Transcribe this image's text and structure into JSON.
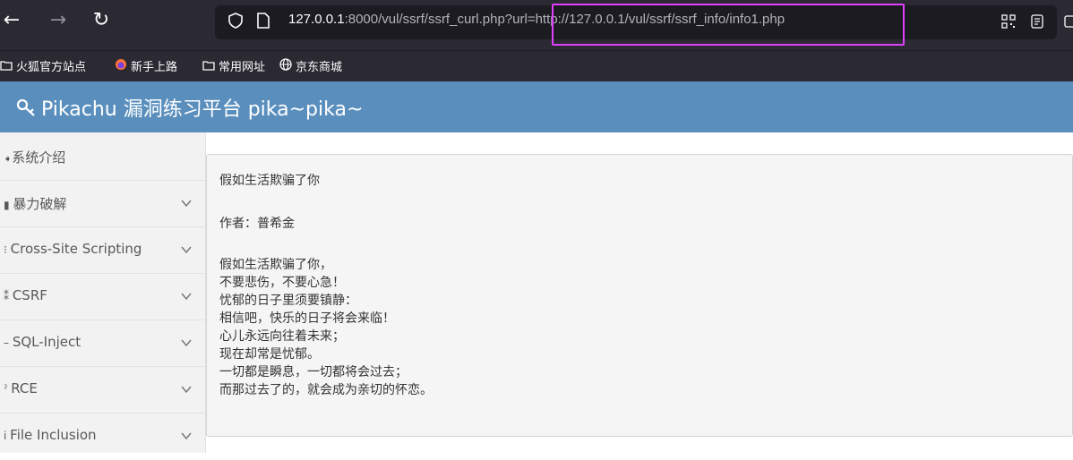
{
  "browser": {
    "url_host": "127.0.0.1",
    "url_rest": ":8000/vul/ssrf/ssrf_curl.php?url=http://127.0.0.1/vul/ssrf/ssrf_info/info1.php",
    "bookmarks": [
      "火狐官方站点",
      "新手上路",
      "常用网址",
      "京东商城"
    ]
  },
  "header": {
    "title": "Pikachu 漏洞练习平台 pika~pika~"
  },
  "sidebar": {
    "items": [
      {
        "label": "系统介绍",
        "icon": "arrow-circle-icon"
      },
      {
        "label": "暴力破解",
        "icon": "lock-icon"
      },
      {
        "label": "Cross-Site Scripting",
        "icon": "list-icon"
      },
      {
        "label": "CSRF",
        "icon": "exchange-icon"
      },
      {
        "label": "SQL-Inject",
        "icon": "minus-icon"
      },
      {
        "label": "RCE",
        "icon": "pin-icon"
      },
      {
        "label": "File Inclusion",
        "icon": "info-icon"
      }
    ]
  },
  "poem": {
    "title": "假如生活欺骗了你",
    "author": "作者：普希金",
    "lines": [
      "假如生活欺骗了你，",
      "不要悲伤，不要心急！",
      "忧郁的日子里须要镇静：",
      "相信吧，快乐的日子将会来临！",
      "心儿永远向往着未来；",
      "现在却常是忧郁。",
      "一切都是瞬息，一切都将会过去；",
      "而那过去了的，就会成为亲切的怀恋。"
    ]
  },
  "colors": {
    "header_bg": "#5a8fbd",
    "highlight": "#e040fb"
  }
}
